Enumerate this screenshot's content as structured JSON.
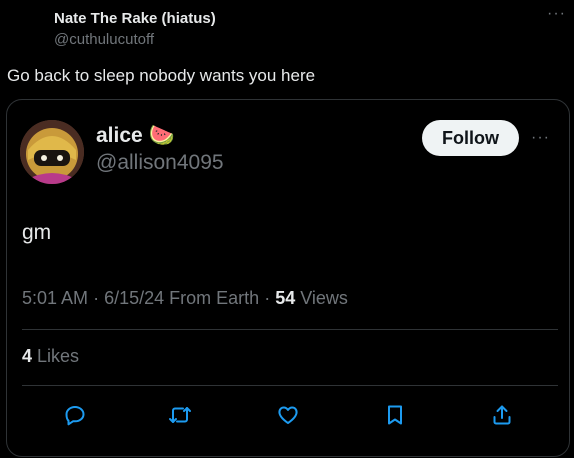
{
  "outer_tweet": {
    "name": "Nate The Rake (hiatus)",
    "handle": "@cuthulucutoff",
    "text": "Go back to sleep nobody wants you here",
    "more_icon": "more-horizontal-icon"
  },
  "quoted_tweet": {
    "name": "alice",
    "name_emoji": "🍉",
    "handle": "@allison4095",
    "follow_label": "Follow",
    "text": "gm",
    "time": "5:01 AM",
    "date": "6/15/24",
    "source": "From Earth",
    "views_count": "54",
    "views_label": "Views",
    "likes_count": "4",
    "likes_label": "Likes"
  },
  "actions": [
    "reply-icon",
    "retweet-icon",
    "like-icon",
    "bookmark-icon",
    "share-icon"
  ],
  "colors": {
    "background": "#000000",
    "text_primary": "#e7e9ea",
    "text_secondary": "#71767b",
    "accent": "#1d9bf0",
    "border": "#2f3336",
    "follow_bg": "#eff3f4"
  }
}
